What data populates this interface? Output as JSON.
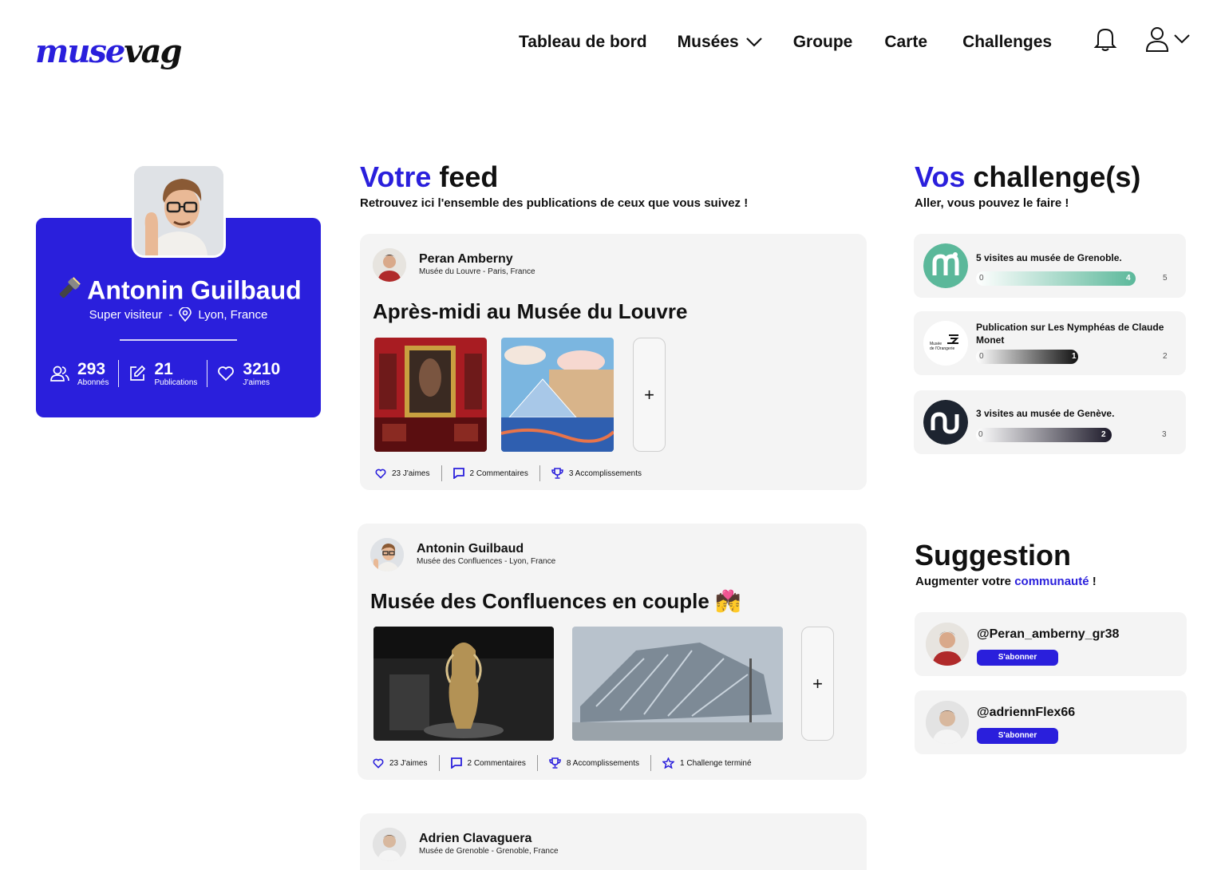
{
  "header": {
    "logo_part1": "muse",
    "logo_part2": "vag",
    "nav": [
      {
        "label": "Tableau de bord"
      },
      {
        "label": "Musées"
      },
      {
        "label": "Groupe"
      },
      {
        "label": "Carte"
      },
      {
        "label": "Challenges"
      }
    ],
    "icons": [
      "bell-icon",
      "user-icon",
      "chevron-down-icon"
    ]
  },
  "profile": {
    "name": "Antonin Guilbaud",
    "title": "Super visiteur",
    "separator": "-",
    "location": "Lyon, France",
    "stats": [
      {
        "value": "293",
        "label": "Abonnés",
        "icon": "users-icon"
      },
      {
        "value": "21",
        "label": "Publications",
        "icon": "edit-icon"
      },
      {
        "value": "3210",
        "label": "J'aimes",
        "icon": "heart-icon"
      }
    ]
  },
  "feed": {
    "title_hl": "Votre",
    "title_rest": " feed",
    "subtitle": "Retrouvez ici l'ensemble des publications de ceux que vous suivez !",
    "posts": [
      {
        "author": "Peran Amberny",
        "place": "Musée du Louvre - Paris, France",
        "title": "Après-midi au Musée du Louvre",
        "actions": [
          "23 J'aimes",
          "2 Commentaires",
          "3 Accomplissements"
        ]
      },
      {
        "author": "Antonin Guilbaud",
        "place": "Musée des Confluences - Lyon, France",
        "title": "Musée des Confluences en couple 💏",
        "actions": [
          "23 J'aimes",
          "2 Commentaires",
          "8 Accomplissements",
          "1 Challenge terminé"
        ]
      },
      {
        "author": "Adrien Clavaguera",
        "place": "Musée de Grenoble - Grenoble, France"
      }
    ],
    "plus": "+"
  },
  "challenges": {
    "title_hl": "Vos",
    "title_rest": " challenge(s)",
    "subtitle": "Aller, vous pouvez le faire !",
    "items": [
      {
        "text": "5 visites au musée de Grenoble.",
        "start": "0",
        "current": "4",
        "goal": "5",
        "progress": 0.8
      },
      {
        "text": "Publication sur Les Nymphéas de Claude Monet",
        "start": "0",
        "current": "1",
        "goal": "2",
        "progress": 0.5
      },
      {
        "text": "3 visites au musée de Genève.",
        "start": "0",
        "current": "2",
        "goal": "3",
        "progress": 0.67
      }
    ],
    "logo_texts": {
      "orangerie": "Musée de l'Orangerie"
    }
  },
  "suggestion": {
    "title": "Suggestion",
    "subtitle_pre": "Augmenter votre ",
    "subtitle_hl": "communauté",
    "subtitle_post": " !",
    "items": [
      {
        "handle": "@Peran_amberny_gr38",
        "button": "S'abonner"
      },
      {
        "handle": "@adriennFlex66",
        "button": "S'abonner"
      }
    ]
  },
  "colors": {
    "accent": "#2a1fdc",
    "card_bg": "#f4f4f4",
    "green": "#5bb89a"
  }
}
